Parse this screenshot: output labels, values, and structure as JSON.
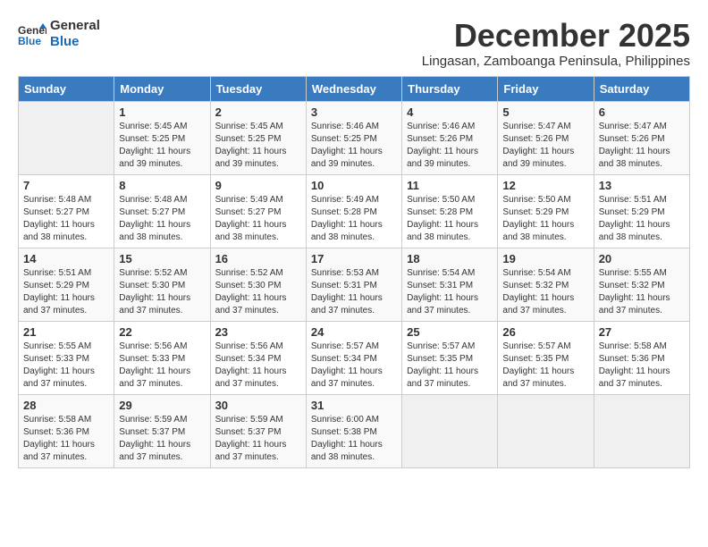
{
  "logo": {
    "general": "General",
    "blue": "Blue"
  },
  "title": "December 2025",
  "location": "Lingasan, Zamboanga Peninsula, Philippines",
  "weekdays": [
    "Sunday",
    "Monday",
    "Tuesday",
    "Wednesday",
    "Thursday",
    "Friday",
    "Saturday"
  ],
  "weeks": [
    [
      {
        "day": "",
        "sunrise": "",
        "sunset": "",
        "daylight": ""
      },
      {
        "day": "1",
        "sunrise": "Sunrise: 5:45 AM",
        "sunset": "Sunset: 5:25 PM",
        "daylight": "Daylight: 11 hours and 39 minutes."
      },
      {
        "day": "2",
        "sunrise": "Sunrise: 5:45 AM",
        "sunset": "Sunset: 5:25 PM",
        "daylight": "Daylight: 11 hours and 39 minutes."
      },
      {
        "day": "3",
        "sunrise": "Sunrise: 5:46 AM",
        "sunset": "Sunset: 5:25 PM",
        "daylight": "Daylight: 11 hours and 39 minutes."
      },
      {
        "day": "4",
        "sunrise": "Sunrise: 5:46 AM",
        "sunset": "Sunset: 5:26 PM",
        "daylight": "Daylight: 11 hours and 39 minutes."
      },
      {
        "day": "5",
        "sunrise": "Sunrise: 5:47 AM",
        "sunset": "Sunset: 5:26 PM",
        "daylight": "Daylight: 11 hours and 39 minutes."
      },
      {
        "day": "6",
        "sunrise": "Sunrise: 5:47 AM",
        "sunset": "Sunset: 5:26 PM",
        "daylight": "Daylight: 11 hours and 38 minutes."
      }
    ],
    [
      {
        "day": "7",
        "sunrise": "Sunrise: 5:48 AM",
        "sunset": "Sunset: 5:27 PM",
        "daylight": "Daylight: 11 hours and 38 minutes."
      },
      {
        "day": "8",
        "sunrise": "Sunrise: 5:48 AM",
        "sunset": "Sunset: 5:27 PM",
        "daylight": "Daylight: 11 hours and 38 minutes."
      },
      {
        "day": "9",
        "sunrise": "Sunrise: 5:49 AM",
        "sunset": "Sunset: 5:27 PM",
        "daylight": "Daylight: 11 hours and 38 minutes."
      },
      {
        "day": "10",
        "sunrise": "Sunrise: 5:49 AM",
        "sunset": "Sunset: 5:28 PM",
        "daylight": "Daylight: 11 hours and 38 minutes."
      },
      {
        "day": "11",
        "sunrise": "Sunrise: 5:50 AM",
        "sunset": "Sunset: 5:28 PM",
        "daylight": "Daylight: 11 hours and 38 minutes."
      },
      {
        "day": "12",
        "sunrise": "Sunrise: 5:50 AM",
        "sunset": "Sunset: 5:29 PM",
        "daylight": "Daylight: 11 hours and 38 minutes."
      },
      {
        "day": "13",
        "sunrise": "Sunrise: 5:51 AM",
        "sunset": "Sunset: 5:29 PM",
        "daylight": "Daylight: 11 hours and 38 minutes."
      }
    ],
    [
      {
        "day": "14",
        "sunrise": "Sunrise: 5:51 AM",
        "sunset": "Sunset: 5:29 PM",
        "daylight": "Daylight: 11 hours and 37 minutes."
      },
      {
        "day": "15",
        "sunrise": "Sunrise: 5:52 AM",
        "sunset": "Sunset: 5:30 PM",
        "daylight": "Daylight: 11 hours and 37 minutes."
      },
      {
        "day": "16",
        "sunrise": "Sunrise: 5:52 AM",
        "sunset": "Sunset: 5:30 PM",
        "daylight": "Daylight: 11 hours and 37 minutes."
      },
      {
        "day": "17",
        "sunrise": "Sunrise: 5:53 AM",
        "sunset": "Sunset: 5:31 PM",
        "daylight": "Daylight: 11 hours and 37 minutes."
      },
      {
        "day": "18",
        "sunrise": "Sunrise: 5:54 AM",
        "sunset": "Sunset: 5:31 PM",
        "daylight": "Daylight: 11 hours and 37 minutes."
      },
      {
        "day": "19",
        "sunrise": "Sunrise: 5:54 AM",
        "sunset": "Sunset: 5:32 PM",
        "daylight": "Daylight: 11 hours and 37 minutes."
      },
      {
        "day": "20",
        "sunrise": "Sunrise: 5:55 AM",
        "sunset": "Sunset: 5:32 PM",
        "daylight": "Daylight: 11 hours and 37 minutes."
      }
    ],
    [
      {
        "day": "21",
        "sunrise": "Sunrise: 5:55 AM",
        "sunset": "Sunset: 5:33 PM",
        "daylight": "Daylight: 11 hours and 37 minutes."
      },
      {
        "day": "22",
        "sunrise": "Sunrise: 5:56 AM",
        "sunset": "Sunset: 5:33 PM",
        "daylight": "Daylight: 11 hours and 37 minutes."
      },
      {
        "day": "23",
        "sunrise": "Sunrise: 5:56 AM",
        "sunset": "Sunset: 5:34 PM",
        "daylight": "Daylight: 11 hours and 37 minutes."
      },
      {
        "day": "24",
        "sunrise": "Sunrise: 5:57 AM",
        "sunset": "Sunset: 5:34 PM",
        "daylight": "Daylight: 11 hours and 37 minutes."
      },
      {
        "day": "25",
        "sunrise": "Sunrise: 5:57 AM",
        "sunset": "Sunset: 5:35 PM",
        "daylight": "Daylight: 11 hours and 37 minutes."
      },
      {
        "day": "26",
        "sunrise": "Sunrise: 5:57 AM",
        "sunset": "Sunset: 5:35 PM",
        "daylight": "Daylight: 11 hours and 37 minutes."
      },
      {
        "day": "27",
        "sunrise": "Sunrise: 5:58 AM",
        "sunset": "Sunset: 5:36 PM",
        "daylight": "Daylight: 11 hours and 37 minutes."
      }
    ],
    [
      {
        "day": "28",
        "sunrise": "Sunrise: 5:58 AM",
        "sunset": "Sunset: 5:36 PM",
        "daylight": "Daylight: 11 hours and 37 minutes."
      },
      {
        "day": "29",
        "sunrise": "Sunrise: 5:59 AM",
        "sunset": "Sunset: 5:37 PM",
        "daylight": "Daylight: 11 hours and 37 minutes."
      },
      {
        "day": "30",
        "sunrise": "Sunrise: 5:59 AM",
        "sunset": "Sunset: 5:37 PM",
        "daylight": "Daylight: 11 hours and 37 minutes."
      },
      {
        "day": "31",
        "sunrise": "Sunrise: 6:00 AM",
        "sunset": "Sunset: 5:38 PM",
        "daylight": "Daylight: 11 hours and 38 minutes."
      },
      {
        "day": "",
        "sunrise": "",
        "sunset": "",
        "daylight": ""
      },
      {
        "day": "",
        "sunrise": "",
        "sunset": "",
        "daylight": ""
      },
      {
        "day": "",
        "sunrise": "",
        "sunset": "",
        "daylight": ""
      }
    ]
  ]
}
